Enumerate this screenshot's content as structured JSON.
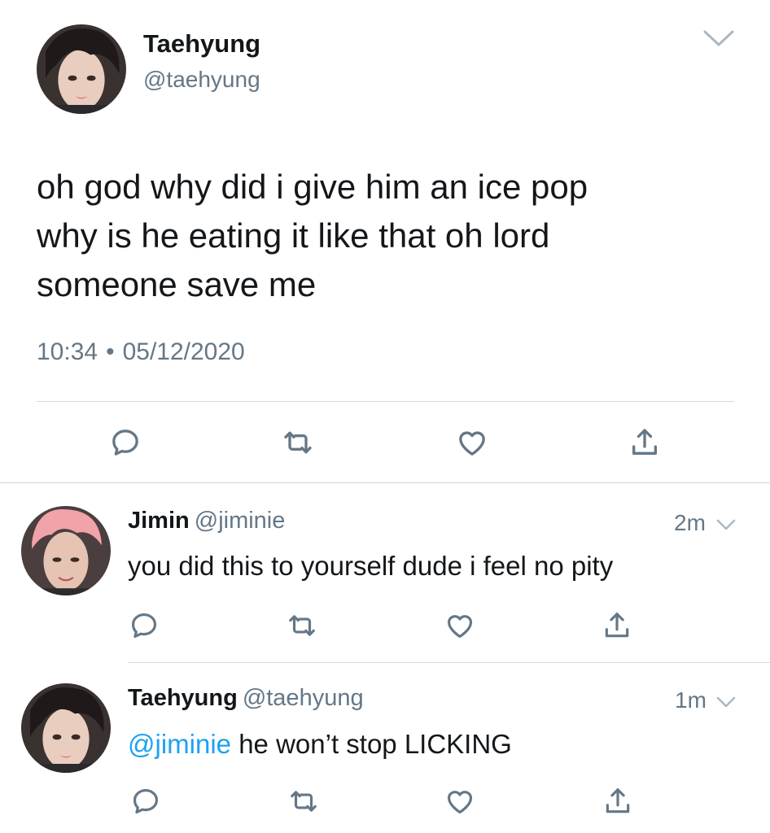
{
  "main_tweet": {
    "display_name": "Taehyung",
    "handle": "@taehyung",
    "text_lines": [
      "oh god why did i give him an ice pop",
      "why is he eating it like that oh lord",
      "someone save me"
    ],
    "time": "10:34",
    "separator": "•",
    "date": "05/12/2020"
  },
  "replies": [
    {
      "display_name": "Jimin",
      "handle": "@jiminie",
      "time_ago": "2m",
      "text": "you did this to yourself dude i feel no pity"
    },
    {
      "display_name": "Taehyung",
      "handle": "@taehyung",
      "time_ago": "1m",
      "mention": "@jiminie",
      "text": " he won’t stop LICKING"
    }
  ],
  "icons": {
    "reply": "speech-bubble-icon",
    "retweet": "retweet-arrows-icon",
    "like": "heart-icon",
    "share": "share-upload-icon",
    "more": "chevron-down-icon"
  },
  "colors": {
    "text": "#14171a",
    "secondary": "#657786",
    "icon": "#657786",
    "mention": "#1da1f2",
    "divider": "#d7dbdf"
  }
}
